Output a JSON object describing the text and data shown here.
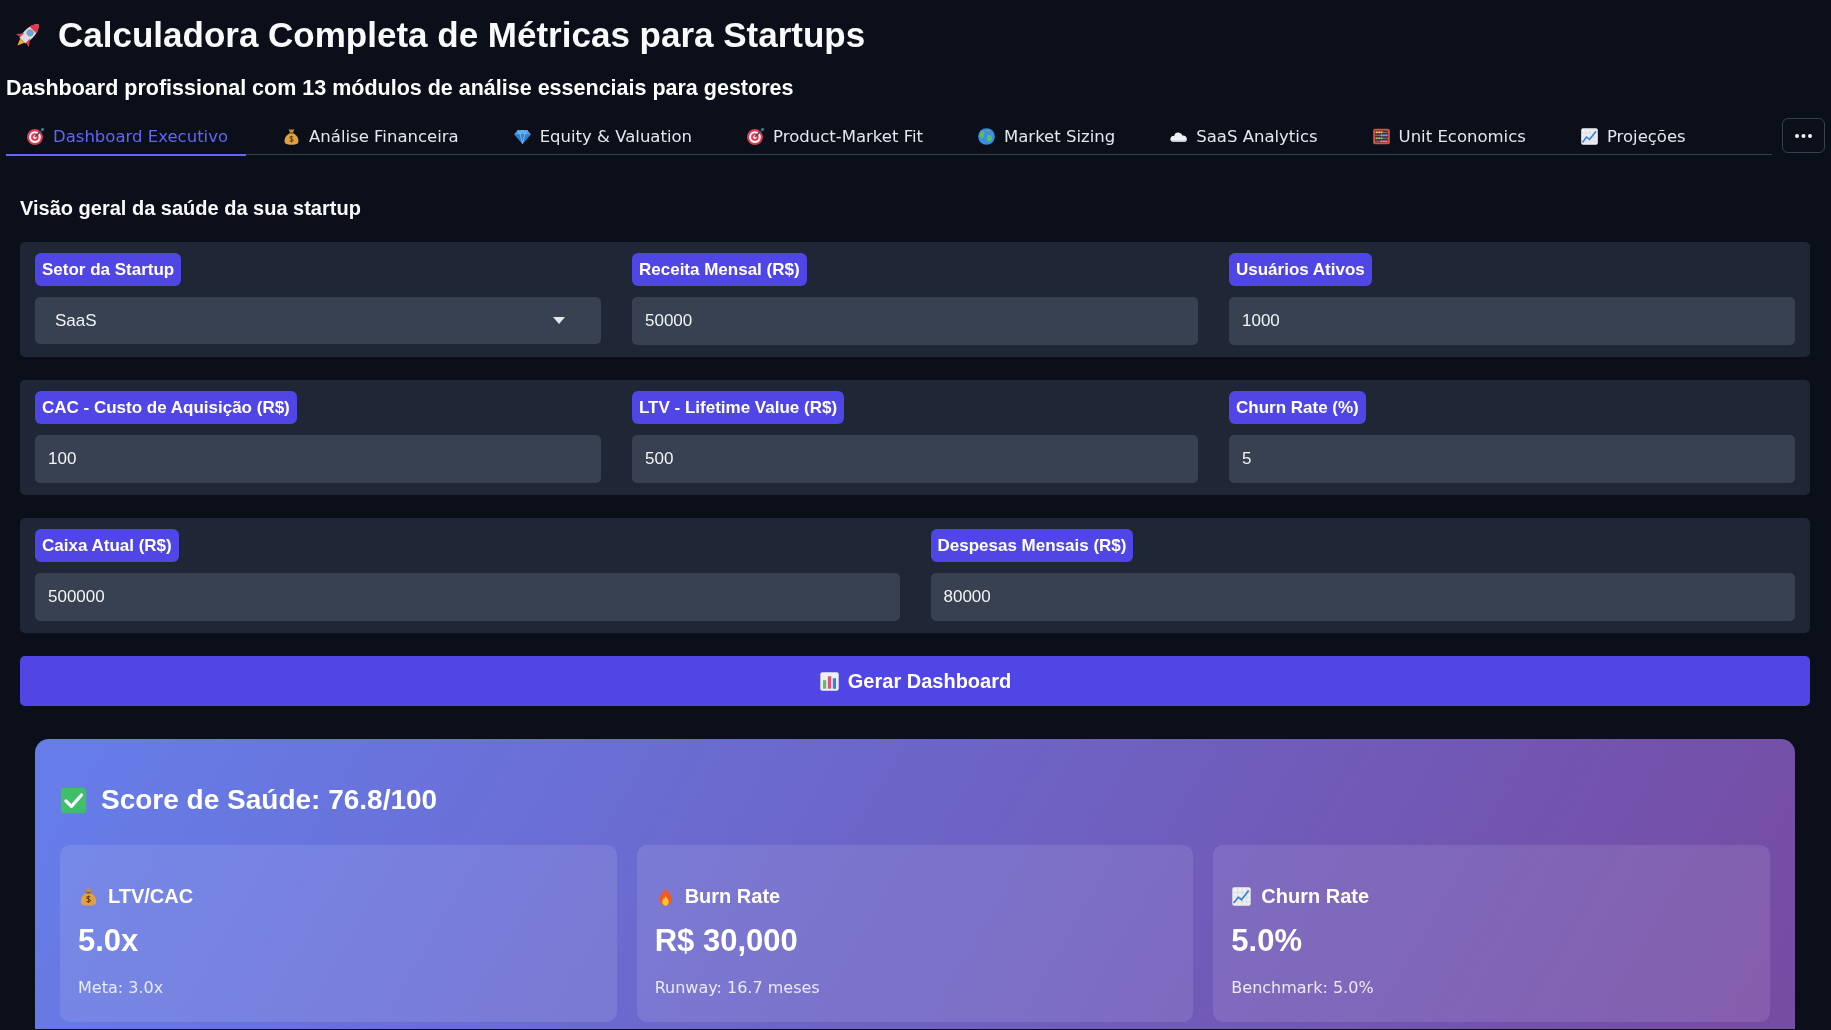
{
  "header": {
    "title": "Calculadora Completa de Métricas para Startups",
    "subtitle": "Dashboard profissional com 13 módulos de análise essenciais para gestores"
  },
  "tabs": [
    {
      "label": "Dashboard Executivo",
      "selected": true
    },
    {
      "label": "Análise Financeira",
      "selected": false
    },
    {
      "label": "Equity & Valuation",
      "selected": false
    },
    {
      "label": "Product-Market Fit",
      "selected": false
    },
    {
      "label": "Market Sizing",
      "selected": false
    },
    {
      "label": "SaaS Analytics",
      "selected": false
    },
    {
      "label": "Unit Economics",
      "selected": false
    },
    {
      "label": "Projeções",
      "selected": false
    }
  ],
  "section_title": "Visão geral da saúde da sua startup",
  "form_groups": [
    {
      "fields": [
        {
          "label": "Setor da Startup",
          "kind": "select",
          "value": "SaaS"
        },
        {
          "label": "Receita Mensal (R$)",
          "kind": "number",
          "value": "50000"
        },
        {
          "label": "Usuários Ativos",
          "kind": "number",
          "value": "1000"
        }
      ]
    },
    {
      "fields": [
        {
          "label": "CAC - Custo de Aquisição (R$)",
          "kind": "number",
          "value": "100"
        },
        {
          "label": "LTV - Lifetime Value (R$)",
          "kind": "number",
          "value": "500"
        },
        {
          "label": "Churn Rate (%)",
          "kind": "number",
          "value": "5"
        }
      ]
    },
    {
      "fields": [
        {
          "label": "Caixa Atual (R$)",
          "kind": "number",
          "value": "500000"
        },
        {
          "label": "Despesas Mensais (R$)",
          "kind": "number",
          "value": "80000"
        }
      ]
    }
  ],
  "generate_button": {
    "label": "Gerar Dashboard"
  },
  "score_card": {
    "title": "Score de Saúde: 76.8/100",
    "metrics": [
      {
        "label": "LTV/CAC",
        "value": "5.0x",
        "note": "Meta: 3.0x"
      },
      {
        "label": "Burn Rate",
        "value": "R$ 30,000",
        "note": "Runway: 16.7 meses"
      },
      {
        "label": "Churn Rate",
        "value": "5.0%",
        "note": "Benchmark: 5.0%"
      }
    ]
  }
}
